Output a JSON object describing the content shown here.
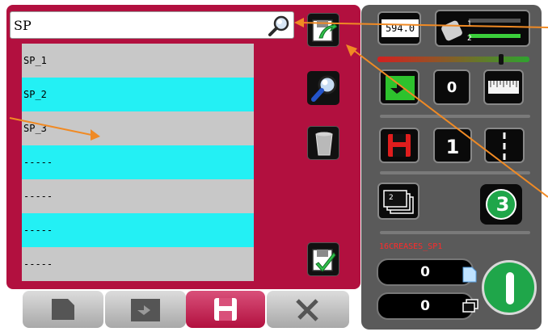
{
  "search": {
    "value": "SP"
  },
  "list": {
    "items": [
      {
        "label": "SP_1",
        "color": "gray"
      },
      {
        "label": "SP_2",
        "color": "cyan"
      },
      {
        "label": "SP_3",
        "color": "gray"
      },
      {
        "label": "-----",
        "color": "cyan"
      },
      {
        "label": "-----",
        "color": "gray"
      },
      {
        "label": "-----",
        "color": "cyan"
      },
      {
        "label": "-----",
        "color": "gray"
      }
    ]
  },
  "right": {
    "length_value": "594.0",
    "mode_value": "0",
    "program_number": "1",
    "copies_label": "2",
    "speed_number": "3",
    "job_name": "16CREASES_SP1",
    "counter_docs": "0",
    "counter_sets": "0"
  },
  "colors": {
    "panel": "#b2103f",
    "cyan": "#23f0f4",
    "row_gray": "#c8c8c8",
    "right_panel": "#5a5a5a",
    "start_green": "#1fa64a",
    "arrow": "#f08a24"
  },
  "icons": [
    "search-icon",
    "save-export-icon",
    "magnifier-icon",
    "trash-icon",
    "load-icon",
    "document-tab-icon",
    "crease-tab-icon",
    "save-tab-icon",
    "tools-tab-icon",
    "roller-icon",
    "ruler-icon",
    "floppy-icon",
    "dashed-line-icon",
    "stack-icon",
    "doc-icon",
    "sets-icon",
    "start-icon"
  ]
}
